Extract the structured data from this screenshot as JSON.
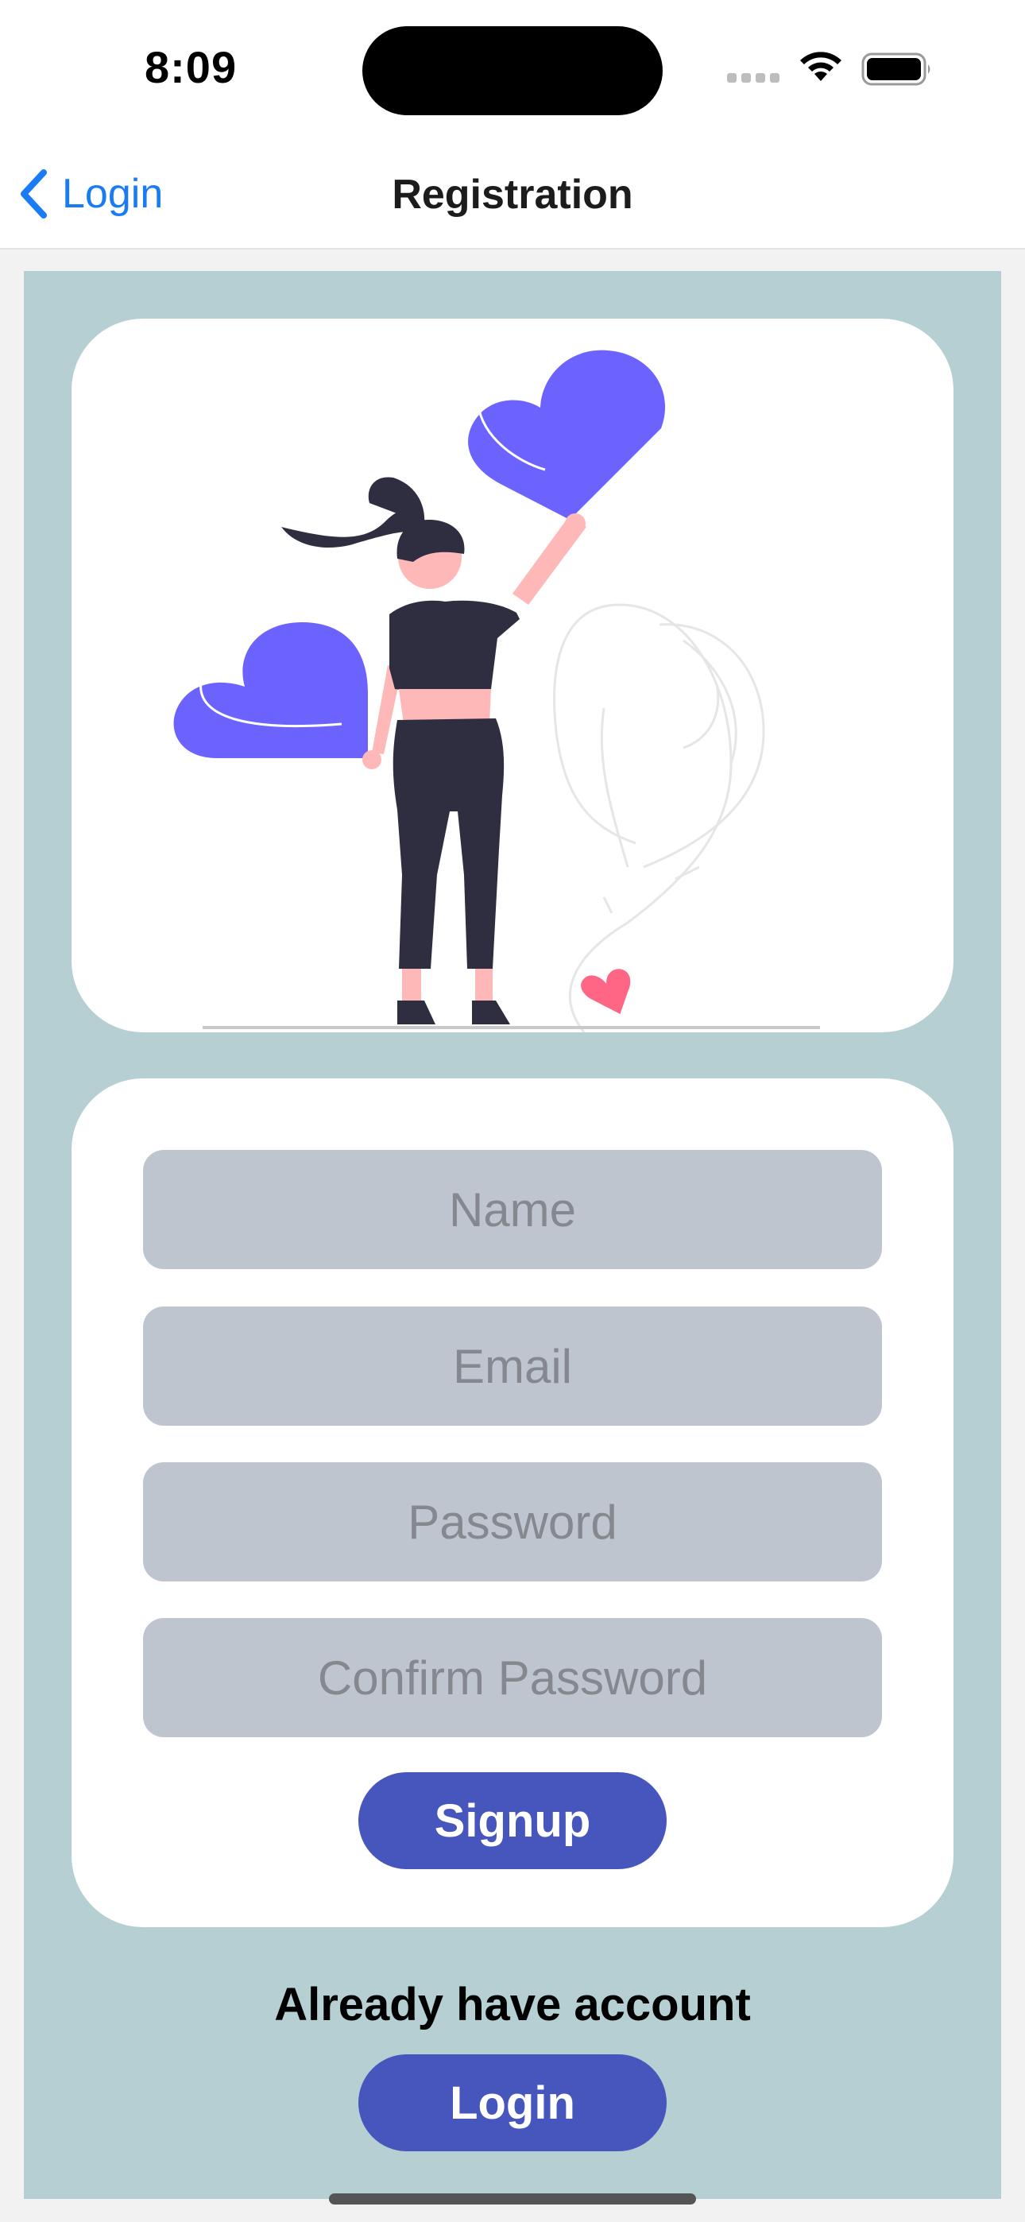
{
  "status_bar": {
    "time": "8:09"
  },
  "nav": {
    "back_label": "Login",
    "title": "Registration"
  },
  "colors": {
    "panel_bg": "#b6cfd2",
    "card_bg": "#ffffff",
    "field_bg": "#bfc5cf",
    "button_bg": "#4756bd",
    "accent_link": "#1a7cf5",
    "heart_purple": "#6c63ff",
    "heart_pink": "#ff6584"
  },
  "hero": {
    "illustration": "woman-holding-hearts-illustration"
  },
  "form": {
    "name_placeholder": "Name",
    "email_placeholder": "Email",
    "password_placeholder": "Password",
    "confirm_password_placeholder": "Confirm Password",
    "signup_label": "Signup"
  },
  "footer": {
    "prompt": "Already have account",
    "login_label": "Login"
  }
}
